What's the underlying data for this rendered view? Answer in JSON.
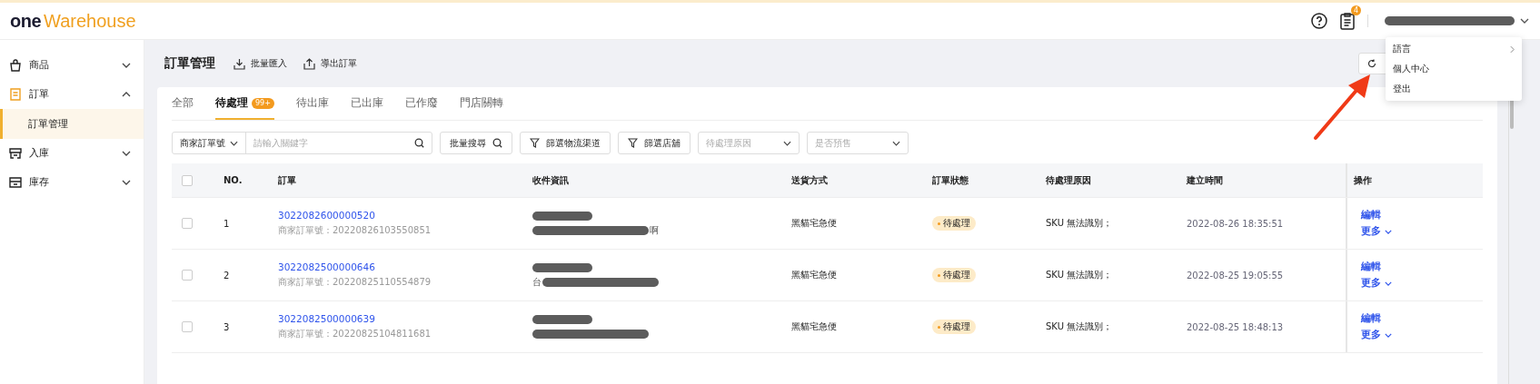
{
  "header": {
    "logo_one": "one",
    "logo_rest": "Warehouse",
    "notification_count": "4"
  },
  "user_menu": [
    {
      "label": "語言",
      "submenu": true
    },
    {
      "label": "個人中心",
      "submenu": false
    },
    {
      "label": "登出",
      "submenu": false
    }
  ],
  "sidebar": {
    "items": [
      {
        "label": "商品",
        "expanded": false
      },
      {
        "label": "訂單",
        "expanded": true,
        "children": [
          {
            "label": "訂單管理",
            "selected": true
          }
        ]
      },
      {
        "label": "入庫",
        "expanded": false
      },
      {
        "label": "庫存",
        "expanded": false
      }
    ]
  },
  "page": {
    "title": "訂單管理",
    "actions": [
      {
        "label": "批量匯入",
        "kind": "import"
      },
      {
        "label": "導出訂單",
        "kind": "export"
      }
    ]
  },
  "tabs": [
    {
      "label": "全部",
      "selected": false
    },
    {
      "label": "待處理",
      "selected": true,
      "badge": "99+"
    },
    {
      "label": "待出庫",
      "selected": false
    },
    {
      "label": "已出庫",
      "selected": false
    },
    {
      "label": "已作廢",
      "selected": false
    },
    {
      "label": "門店關轉",
      "selected": false
    }
  ],
  "filters": {
    "search_type": "商家訂單號",
    "search_placeholder": "請輸入關鍵字",
    "batch_search": "批量搜尋",
    "filter_buttons": [
      "篩選物流渠道",
      "篩選店舖"
    ],
    "selects": [
      "待處理原因",
      "是否預售"
    ]
  },
  "table": {
    "all_checked": false,
    "columns": [
      "NO.",
      "訂單",
      "收件資訊",
      "送貨方式",
      "訂單狀態",
      "待處理原因",
      "建立時間",
      "操作"
    ],
    "rows": [
      {
        "checked": false,
        "no": "1",
        "order_id": "3022082600000520",
        "merchant_order": "商家訂單號：20220826103550851",
        "recipient": [
          {
            "kind": "redacted"
          },
          {
            "kind": "redacted",
            "after": "啊"
          }
        ],
        "shipping": "黑貓宅急便",
        "status": "待處理",
        "reason": "SKU 無法識別；",
        "created": "2022-08-26 18:35:51",
        "actions": [
          "編輯",
          "更多"
        ]
      },
      {
        "checked": false,
        "no": "2",
        "order_id": "3022082500000646",
        "merchant_order": "商家訂單號：20220825110554879",
        "recipient": [
          {
            "kind": "redacted"
          },
          {
            "kind": "redacted",
            "before": "台"
          }
        ],
        "shipping": "黑貓宅急便",
        "status": "待處理",
        "reason": "SKU 無法識別；",
        "created": "2022-08-25 19:05:55",
        "actions": [
          "編輯",
          "更多"
        ]
      },
      {
        "checked": false,
        "no": "3",
        "order_id": "3022082500000639",
        "merchant_order": "商家訂單號：20220825104811681",
        "recipient": [
          {
            "kind": "redacted"
          },
          {
            "kind": "redacted"
          }
        ],
        "shipping": "黑貓宅急便",
        "status": "待處理",
        "reason": "SKU 無法識別；",
        "created": "2022-08-25 18:48:13",
        "actions": [
          "編輯",
          "更多"
        ]
      }
    ]
  }
}
